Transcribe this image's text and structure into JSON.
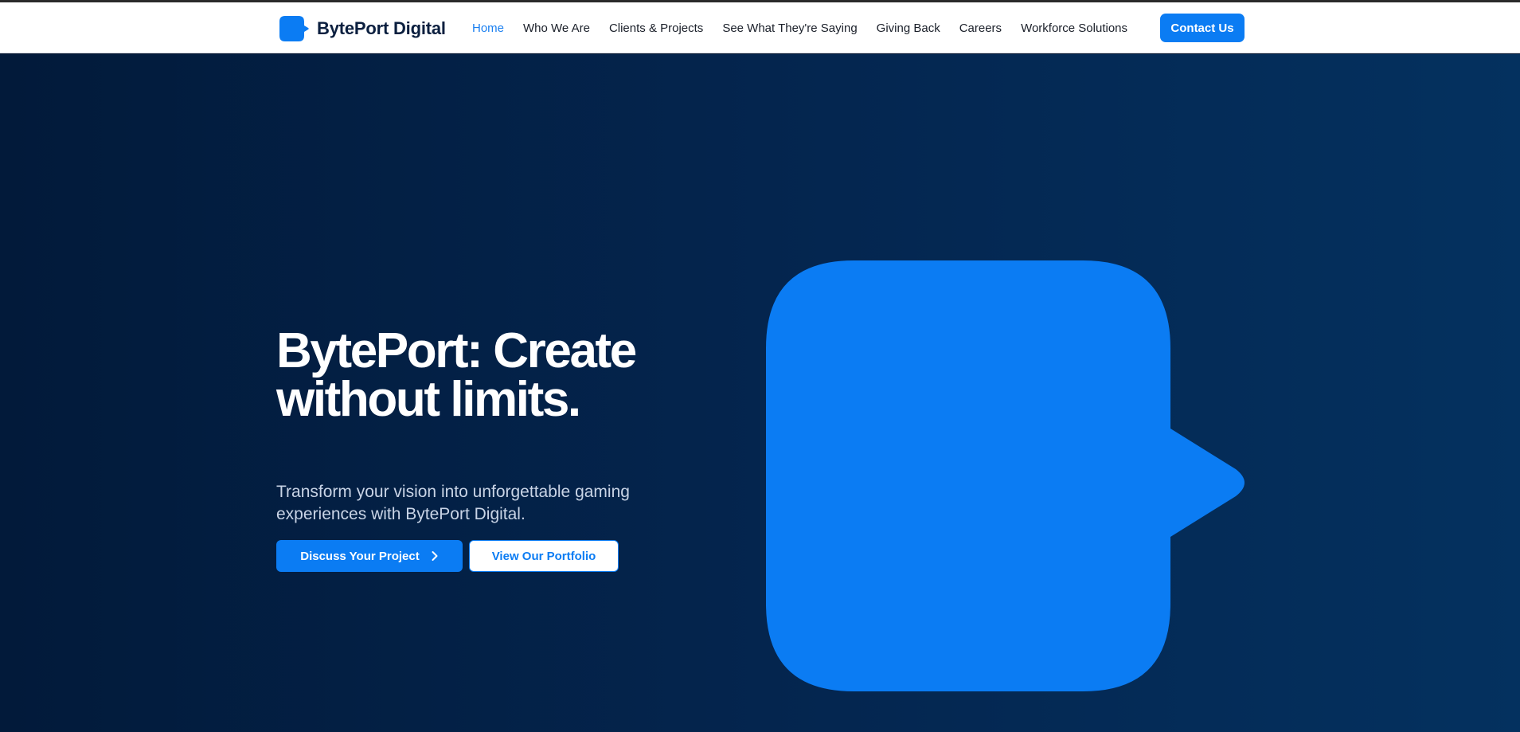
{
  "brand": {
    "name": "BytePort Digital",
    "icon": "chat-bubble-logo-icon"
  },
  "nav": {
    "links": [
      {
        "label": "Home",
        "active": true
      },
      {
        "label": "Who We Are",
        "active": false
      },
      {
        "label": "Clients & Projects",
        "active": false
      },
      {
        "label": "See What They're Saying",
        "active": false
      },
      {
        "label": "Giving Back",
        "active": false
      },
      {
        "label": "Careers",
        "active": false
      },
      {
        "label": "Workforce Solutions",
        "active": false
      }
    ],
    "contact_label": "Contact Us"
  },
  "hero": {
    "title_line1": "BytePort: Create",
    "title_line2": "without limits.",
    "subtitle": "Transform your vision into unforgettable gaming experiences with BytePort Digital.",
    "primary_button": "Discuss Your Project",
    "primary_button_icon": "chevron-right-icon",
    "secondary_button": "View Our Portfolio",
    "graphic": "chat-bubble-graphic"
  },
  "colors": {
    "accent": "#0b7cf3",
    "brand_text": "#0b1f3f",
    "hero_bg_start": "#021a3a",
    "hero_bg_end": "#04315f",
    "nav_text": "#1a1f29",
    "subtitle_text": "#c9d4e6"
  }
}
